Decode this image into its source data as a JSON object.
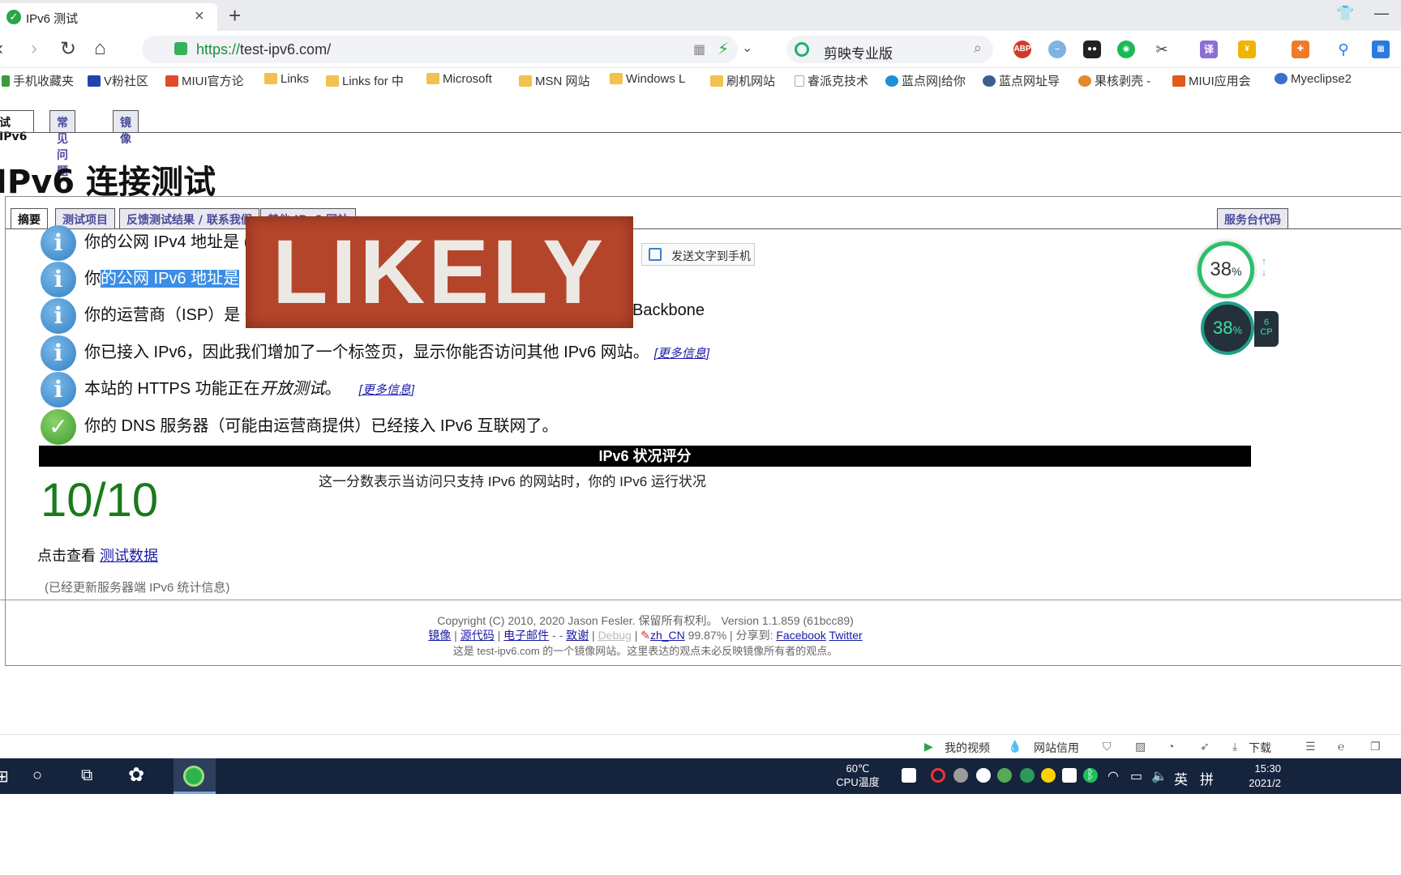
{
  "browser": {
    "tab_title": "IPv6 测试",
    "tab_close": "×",
    "new_tab": "+",
    "url_scheme": "https://",
    "url_rest": "test-ipv6.com/",
    "search_text": "剪映专业版"
  },
  "bookmarks": [
    {
      "label": "手机收藏夹",
      "color": "#3c9b3c"
    },
    {
      "label": "V粉社区",
      "color": "#2244aa"
    },
    {
      "label": "MIUI官方论",
      "color": "#e24a2a"
    },
    {
      "label": "Links",
      "color": "#f2c14e"
    },
    {
      "label": "Links for 中",
      "color": "#f2c14e"
    },
    {
      "label": "Microsoft",
      "color": "#f2c14e"
    },
    {
      "label": "MSN 网站",
      "color": "#f2c14e"
    },
    {
      "label": "Windows L",
      "color": "#f2c14e"
    },
    {
      "label": "刷机网站",
      "color": "#f2c14e"
    },
    {
      "label": "睿派克技术",
      "color": "#cccccc"
    },
    {
      "label": "蓝点网|给你",
      "color": "#1f8fd6"
    },
    {
      "label": "蓝点网址导",
      "color": "#3a5f8f"
    },
    {
      "label": "果核剥壳 -",
      "color": "#e08a2a"
    },
    {
      "label": "MIUI应用会",
      "color": "#e05a1a"
    },
    {
      "label": "Myeclipse2",
      "color": "#3a6fd0"
    }
  ],
  "site_tabs": [
    "试 IPv6",
    "常见问题",
    "镜像"
  ],
  "page_title": "IPv6 连接测试",
  "subtabs": [
    "摘要",
    "测试项目",
    "反馈测试结果 / 联系我们",
    "其他 IPv6 网站"
  ],
  "subtab_right": "服务台代码",
  "results": [
    {
      "icon": "info",
      "text": "你的公网 IPv4 地址是 (",
      "more": ""
    },
    {
      "icon": "info",
      "prefix": "你",
      "selected": "的公网 IPv6 地址是",
      "more": ""
    },
    {
      "icon": "info",
      "text": "你的运营商（ISP）是 C",
      "tail": "Backbone",
      "more": ""
    },
    {
      "icon": "info",
      "text": "你已接入 IPv6，因此我们增加了一个标签页，显示你能否访问其他 IPv6 网站。",
      "more": "[更多信息]"
    },
    {
      "icon": "info",
      "text": "本站的 HTTPS 功能正在",
      "italic": "开放测试",
      "after": "。",
      "more": "[更多信息]"
    },
    {
      "icon": "check",
      "text": "你的 DNS 服务器（可能由运营商提供）已经接入 IPv6 互联网了。",
      "more": ""
    }
  ],
  "score": {
    "header": "IPv6 状况评分",
    "value": "10/10",
    "description": "这一分数表示当访问只支持 IPv6 的网站时，你的 IPv6 运行状况",
    "view_prefix": "点击查看",
    "view_link": "测试数据",
    "stats_note": "(已经更新服务器端 IPv6 统计信息)"
  },
  "footer": {
    "copyright": "Copyright (C) 2010, 2020 Jason Fesler. 保留所有权利。 Version 1.1.859 (61bcc89)",
    "links": {
      "mirror": "镜像",
      "source": "源代码",
      "email": "电子邮件",
      "dash": "-",
      "thanks": "致谢",
      "debug": "Debug",
      "locale": "zh_CN",
      "locale_pct": "99.87%",
      "share": "分享到:",
      "facebook": "Facebook",
      "twitter": "Twitter"
    },
    "mirror_note": "这是 test-ipv6.com 的一个镜像网站。这里表达的观点未必反映镜像所有者的观点。"
  },
  "popup": {
    "send_label": "发送文字到手机"
  },
  "overlay": {
    "text": "LIKELY"
  },
  "widgets": {
    "memory_pct": "38",
    "cpu_pct": "38",
    "pct_sign": "%",
    "side_top": "6",
    "side_bottom": "CP"
  },
  "statusbar": {
    "my_video": "我的视频",
    "site_credit": "网站信用",
    "download": "下载"
  },
  "taskbar": {
    "cpu_temp": "60℃",
    "cpu_label": "CPU温度",
    "ime": "英",
    "time": "15:30",
    "date": "2021/2"
  }
}
